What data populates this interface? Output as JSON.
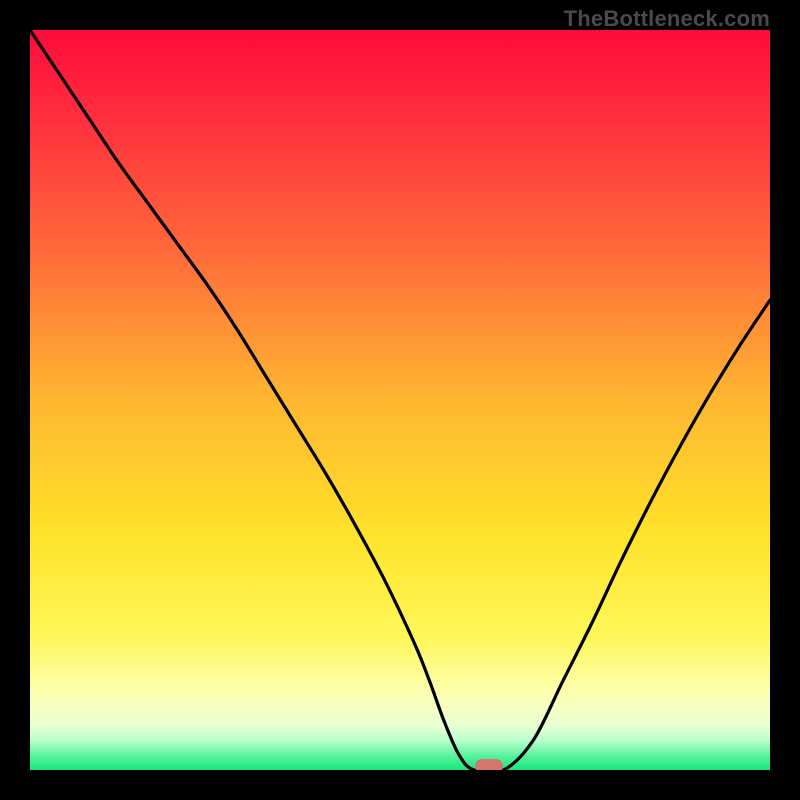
{
  "watermark": "TheBottleneck.com",
  "colors": {
    "marker": "#d1776f",
    "curve": "#000000",
    "curve_width": 3.2,
    "gradient_stops": [
      {
        "pct": 0,
        "color": "#ff0a3a"
      },
      {
        "pct": 12,
        "color": "#ff2f3e"
      },
      {
        "pct": 30,
        "color": "#ff6a3a"
      },
      {
        "pct": 50,
        "color": "#ffb631"
      },
      {
        "pct": 68,
        "color": "#ffe22a"
      },
      {
        "pct": 82,
        "color": "#fff759"
      },
      {
        "pct": 90,
        "color": "#fcffb4"
      },
      {
        "pct": 94,
        "color": "#e8ffd2"
      },
      {
        "pct": 96,
        "color": "#b8ffcd"
      },
      {
        "pct": 98,
        "color": "#5cf39e"
      },
      {
        "pct": 100,
        "color": "#1be57a"
      }
    ]
  },
  "chart_data": {
    "type": "line",
    "title": "",
    "xlabel": "",
    "ylabel": "",
    "xlim": [
      0,
      100
    ],
    "ylim": [
      0,
      100
    ],
    "x": [
      0,
      4,
      8,
      12,
      16,
      20,
      24,
      28,
      32,
      36,
      40,
      44,
      48,
      52,
      54,
      56,
      58,
      60,
      64,
      68,
      72,
      76,
      80,
      84,
      88,
      92,
      96,
      100
    ],
    "values": [
      100,
      94,
      88,
      82,
      76.5,
      71,
      65.5,
      59.5,
      53,
      46.5,
      40,
      33,
      25.5,
      17,
      12,
      6.5,
      2,
      0,
      0,
      4,
      12,
      20,
      28.5,
      36.5,
      44,
      51,
      57.5,
      63.5
    ],
    "marker": {
      "x": 62,
      "y": 0
    },
    "flat_bottom": {
      "x_start": 58,
      "x_end": 65
    },
    "note": "V-shaped bottleneck curve; y=0 is optimal (green), y=100 is worst (red). Values estimated from pixel positions."
  }
}
